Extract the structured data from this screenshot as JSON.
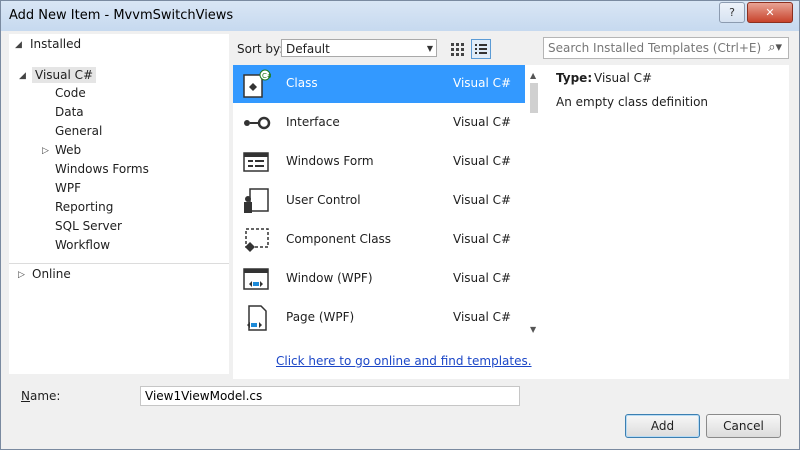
{
  "window": {
    "title": "Add New Item - MvvmSwitchViews"
  },
  "tree": {
    "installed": "Installed",
    "visual_csharp": "Visual C#",
    "children": [
      "Code",
      "Data",
      "General",
      "Web",
      "Windows Forms",
      "WPF",
      "Reporting",
      "SQL Server",
      "Workflow"
    ],
    "online": "Online"
  },
  "toolbar": {
    "sort_label": "Sort by:",
    "sort_value": "Default"
  },
  "templates": [
    {
      "name": "Class",
      "language": "Visual C#",
      "icon": "class-icon",
      "selected": true
    },
    {
      "name": "Interface",
      "language": "Visual C#",
      "icon": "interface-icon"
    },
    {
      "name": "Windows Form",
      "language": "Visual C#",
      "icon": "windows-form-icon"
    },
    {
      "name": "User Control",
      "language": "Visual C#",
      "icon": "user-control-icon"
    },
    {
      "name": "Component Class",
      "language": "Visual C#",
      "icon": "component-class-icon"
    },
    {
      "name": "Window (WPF)",
      "language": "Visual C#",
      "icon": "wpf-window-icon"
    },
    {
      "name": "Page (WPF)",
      "language": "Visual C#",
      "icon": "wpf-page-icon"
    }
  ],
  "online_link": "Click here to go online and find templates.",
  "search": {
    "placeholder": "Search Installed Templates (Ctrl+E)"
  },
  "details": {
    "type_label": "Type:",
    "type_value": "Visual C#",
    "description": "An empty class definition"
  },
  "name_field": {
    "label": "Name:",
    "value": "View1ViewModel.cs"
  },
  "buttons": {
    "add": "Add",
    "cancel": "Cancel"
  },
  "colors": {
    "selection": "#3399ff",
    "link": "#1c47c7",
    "title_bar": "#c6d9ef"
  }
}
